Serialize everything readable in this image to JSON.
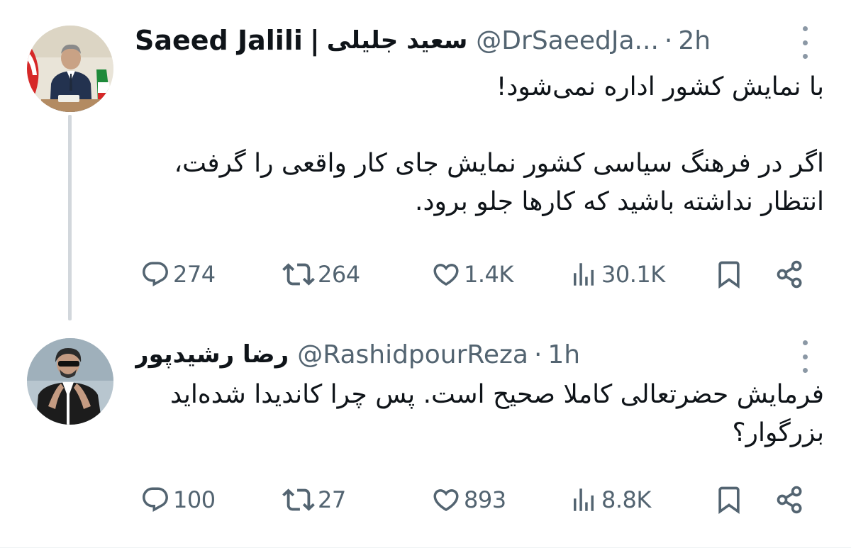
{
  "tweets": [
    {
      "display_name": "Saeed Jalili",
      "name_separator": "|",
      "display_name_fa": "سعید جلیلی",
      "handle": "@DrSaeedJa...",
      "dot": "·",
      "time": "2h",
      "avatar_icon": "person-with-flag-avatar",
      "text": "با نمایش کشور اداره نمی‌شود!\n\nاگر در فرهنگ سیاسی کشور نمایش جای کار واقعی را گرفت، انتظار نداشته باشید که کارها جلو برود.",
      "stats": {
        "replies": "274",
        "retweets": "264",
        "likes": "1.4K",
        "views": "30.1K"
      }
    },
    {
      "display_name": "رضا رشیدپور",
      "handle": "@RashidpourReza",
      "dot": "·",
      "time": "1h",
      "avatar_icon": "person-in-suit-avatar",
      "text": "فرمایش حضرتعالی کاملا صحیح است. پس چرا کاندیدا شده‌اید بزرگوار؟",
      "stats": {
        "replies": "100",
        "retweets": "27",
        "likes": "893",
        "views": "8.8K"
      }
    }
  ],
  "colors": {
    "text": "#0f1419",
    "muted": "#536471",
    "thread_line": "#d2d7dc"
  },
  "icons": [
    "reply-icon",
    "retweet-icon",
    "like-icon",
    "views-icon",
    "bookmark-icon",
    "share-icon",
    "more-options-icon"
  ]
}
